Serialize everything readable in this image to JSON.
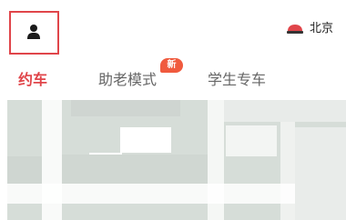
{
  "header": {
    "profile_icon": "user-icon",
    "city": {
      "icon": "car-icon",
      "label": "北京"
    }
  },
  "tabs": [
    {
      "label": "约车",
      "active": true
    },
    {
      "label": "助老模式",
      "badge": "新",
      "active": false
    },
    {
      "label": "学生专车",
      "active": false
    }
  ],
  "colors": {
    "accent": "#e0454a",
    "badge": "#f05a3e",
    "tab_inactive": "#666666",
    "map_green": "#d6ddd8",
    "road": "#ffffff"
  }
}
